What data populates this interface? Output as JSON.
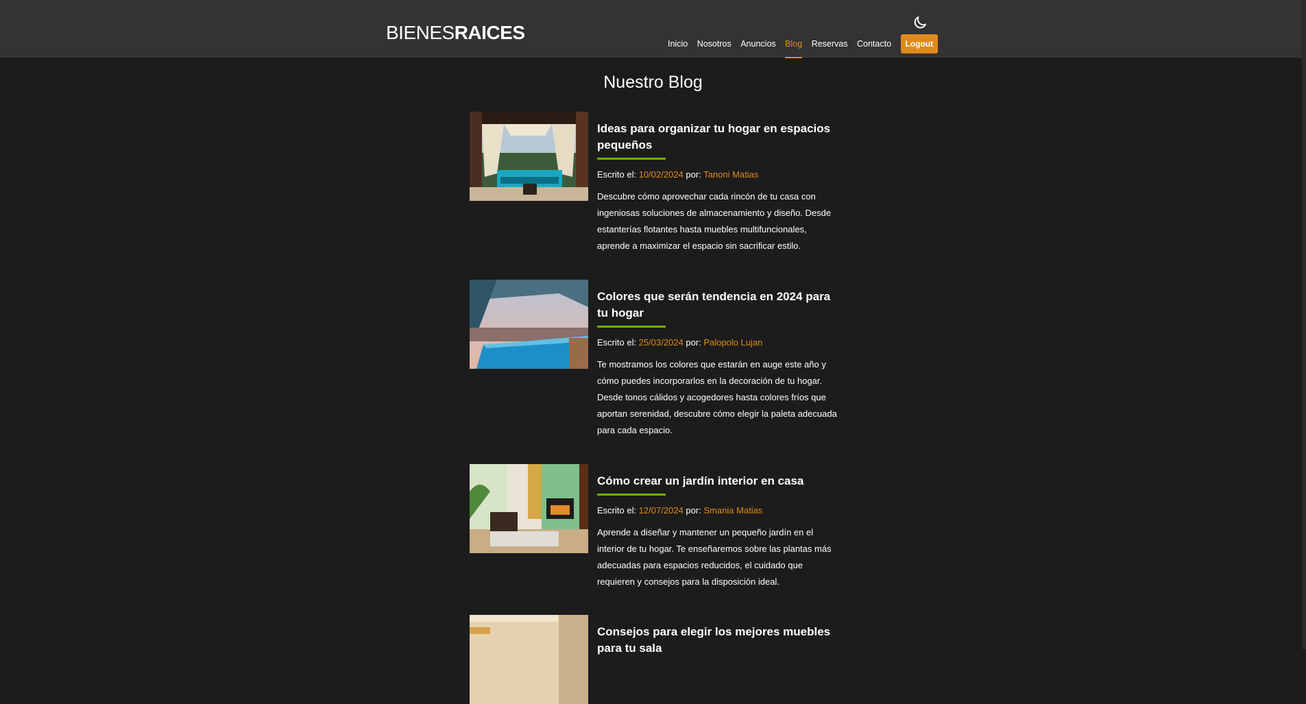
{
  "header": {
    "logo_light": "BIENES",
    "logo_bold": "RAICES",
    "nav": [
      "Inicio",
      "Nosotros",
      "Anuncios",
      "Blog",
      "Reservas",
      "Contacto"
    ],
    "active": "Blog",
    "logout": "Logout",
    "theme_icon": "moon-icon"
  },
  "page_title": "Nuestro Blog",
  "entries": [
    {
      "title": "Ideas para organizar tu hogar en espacios pequeños",
      "meta_prefix": "Escrito el: ",
      "date": "10/02/2024",
      "by": " por: ",
      "author": "Tanoni Matias",
      "text": "Descubre cómo aprovechar cada rincón de tu casa con ingeniosas soluciones de almacenamiento y diseño. Desde estanterías flotantes hasta muebles multifuncionales, aprende a maximizar el espacio sin sacrificar estilo."
    },
    {
      "title": "Colores que serán tendencia en 2024 para tu hogar",
      "meta_prefix": "Escrito el: ",
      "date": "25/03/2024",
      "by": " por: ",
      "author": "Palopolo Lujan",
      "text": "Te mostramos los colores que estarán en auge este año y cómo puedes incorporarlos en la decoración de tu hogar. Desde tonos cálidos y acogedores hasta colores fríos que aportan serenidad, descubre cómo elegir la paleta adecuada para cada espacio."
    },
    {
      "title": "Cómo crear un jardín interior en casa",
      "meta_prefix": "Escrito el: ",
      "date": "12/07/2024",
      "by": " por: ",
      "author": "Smania Matias",
      "text": "Aprende a diseñar y mantener un pequeño jardín en el interior de tu hogar. Te enseñaremos sobre las plantas más adecuadas para espacios reducidos, el cuidado que requieren y consejos para la disposición ideal."
    },
    {
      "title": "Consejos para elegir los mejores muebles para tu sala"
    }
  ],
  "colors": {
    "accent": "#e08a1e",
    "rule": "#71b100",
    "header": "#333333",
    "background": "#1c1c1c"
  }
}
